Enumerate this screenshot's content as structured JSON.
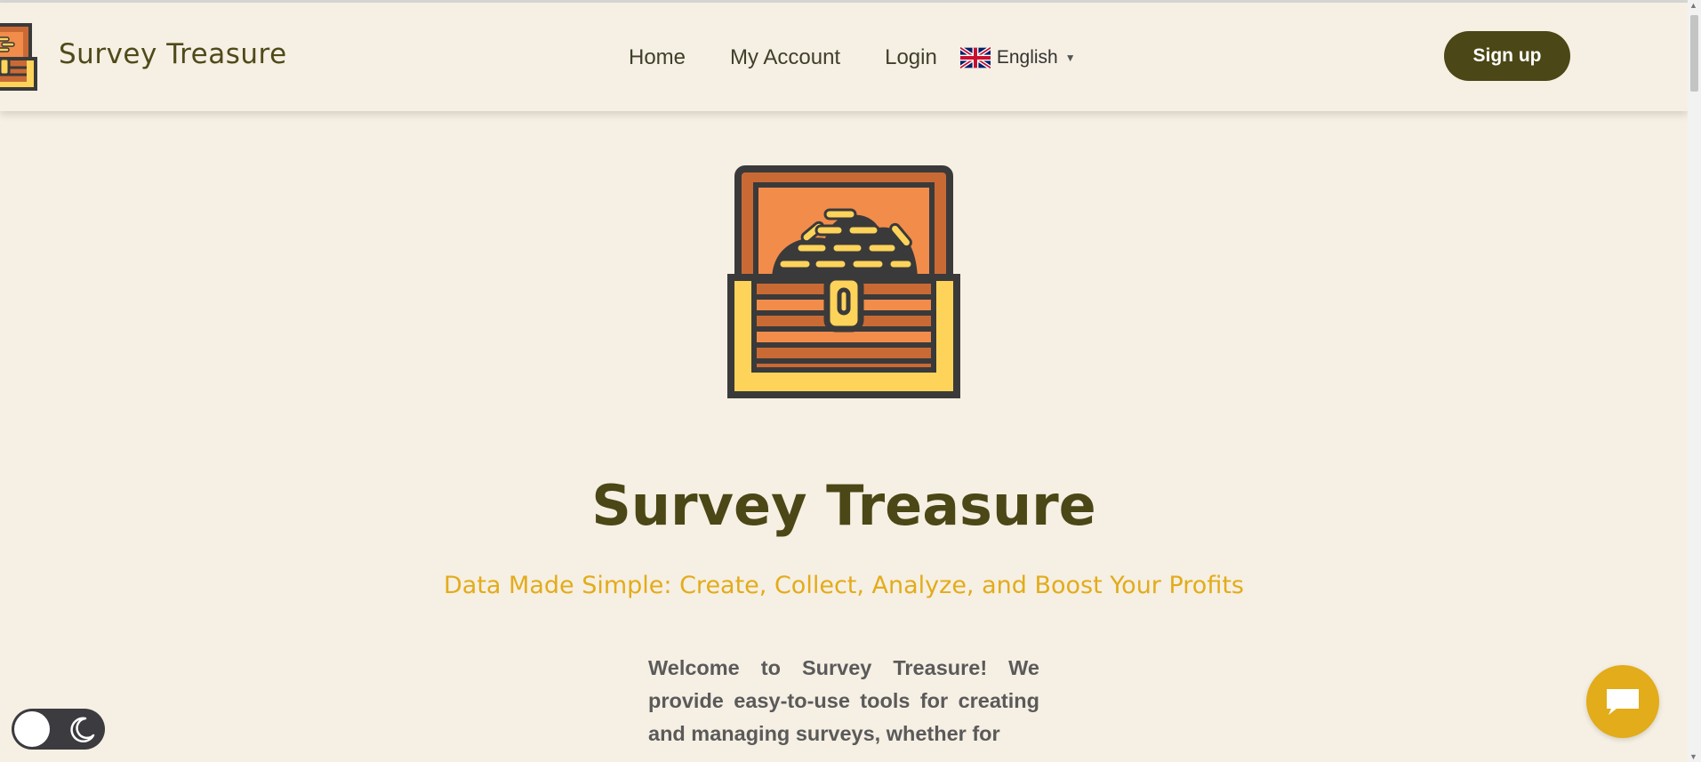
{
  "brand": {
    "name": "Survey Treasure"
  },
  "nav": {
    "items": [
      {
        "label": "Home"
      },
      {
        "label": "My Account"
      },
      {
        "label": "Login"
      }
    ],
    "language": {
      "label": "English"
    }
  },
  "header": {
    "signup_label": "Sign up"
  },
  "hero": {
    "title": "Survey Treasure",
    "subtitle": "Data Made Simple: Create, Collect, Analyze, and Boost Your Profits",
    "intro": "Welcome to Survey Treasure! We provide easy-to-use tools for creating and managing surveys, whether for"
  },
  "icons": {
    "logo": "treasure-chest-icon",
    "flag": "uk-flag-icon",
    "theme": "moon-icon",
    "chat": "chat-bubble-icon"
  },
  "colors": {
    "background": "#f6efe3",
    "brand_dark": "#4b4716",
    "accent_gold": "#e2ac1a",
    "chest_orange": "#f28c4a",
    "chest_brown": "#c96a35",
    "chest_yellow": "#fdd35a"
  }
}
